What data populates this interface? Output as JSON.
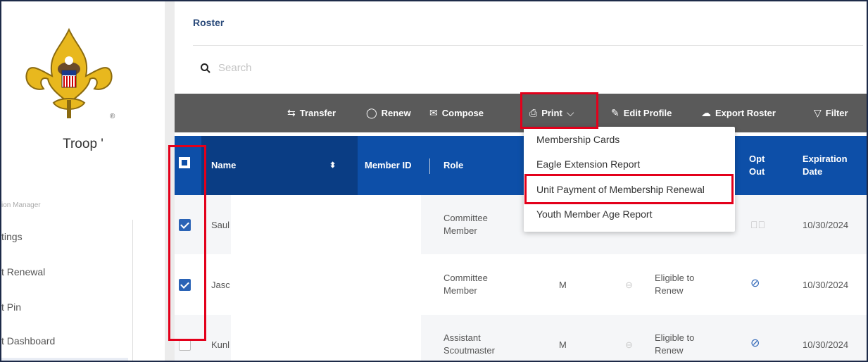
{
  "sidebar": {
    "troop_name": "Troop '",
    "nav_caption": "ion Manager",
    "items": [
      {
        "label": "tings"
      },
      {
        "label": "t Renewal"
      },
      {
        "label": "t Pin"
      },
      {
        "label": "t Dashboard"
      }
    ]
  },
  "header": {
    "title": "Roster",
    "search_placeholder": "Search"
  },
  "toolbar": {
    "transfer": "Transfer",
    "renew": "Renew",
    "compose": "Compose",
    "print": "Print",
    "edit_profile": "Edit Profile",
    "export_roster": "Export Roster",
    "filter": "Filter"
  },
  "print_menu": {
    "items": [
      "Membership Cards",
      "Eagle Extension Report",
      "Unit Payment of Membership Renewal",
      "Youth Member Age Report"
    ]
  },
  "table": {
    "columns": {
      "name": "Name",
      "member_id": "Member ID",
      "role": "Role",
      "opt_out_1": "Opt",
      "opt_out_2": "Out",
      "expiration_1": "Expiration",
      "expiration_2": "Date"
    },
    "rows": [
      {
        "name": "Saul",
        "role_1": "Committee",
        "role_2": "Member",
        "gender": "",
        "status_1": "",
        "status_2": "",
        "expiration": "10/30/2024",
        "checked": true
      },
      {
        "name": "Jasc",
        "role_1": "Committee",
        "role_2": "Member",
        "gender": "M",
        "status_1": "Eligible to",
        "status_2": "Renew",
        "expiration": "10/30/2024",
        "checked": true
      },
      {
        "name": "Kunl",
        "role_1": "Assistant",
        "role_2": "Scoutmaster",
        "gender": "M",
        "status_1": "Eligible to",
        "status_2": "Renew",
        "expiration": "10/30/2024",
        "checked": false
      }
    ]
  },
  "colors": {
    "header_blue": "#0d4fa8",
    "toolbar_gray": "#5a5a5a",
    "annotation_red": "#e3001b"
  }
}
